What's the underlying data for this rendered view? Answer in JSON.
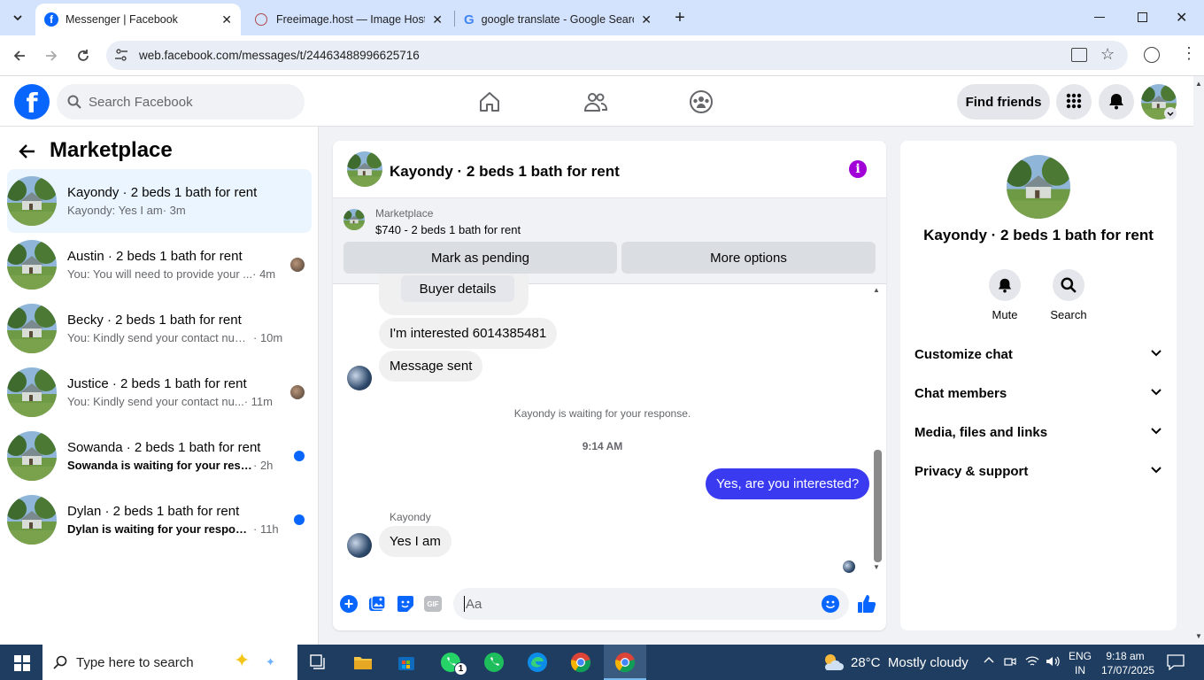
{
  "browser": {
    "tabs": [
      {
        "title": "Messenger | Facebook",
        "active": true
      },
      {
        "title": "Freeimage.host — Image Hosti",
        "active": false
      },
      {
        "title": "google translate - Google Searc",
        "active": false
      }
    ],
    "url": "web.facebook.com/messages/t/24463488996625716"
  },
  "fb_header": {
    "search_placeholder": "Search Facebook",
    "find_friends_label": "Find friends"
  },
  "sidebar": {
    "title": "Marketplace",
    "conversations": [
      {
        "title": "Kayondy · 2 beds 1 bath for rent",
        "preview": "Kayondy: Yes I am",
        "time": "· 3m",
        "unread": false,
        "selected": true,
        "indicator": "none"
      },
      {
        "title": "Austin · 2 beds 1 bath for rent",
        "preview": "You: You will need to provide your ...",
        "time": "· 4m",
        "unread": false,
        "selected": false,
        "indicator": "avatar"
      },
      {
        "title": "Becky · 2 beds 1 bath for rent",
        "preview": "You: Kindly send your contact numb...",
        "time": "· 10m",
        "unread": false,
        "selected": false,
        "indicator": "none"
      },
      {
        "title": "Justice · 2 beds 1 bath for rent",
        "preview": "You: Kindly send your contact nu...",
        "time": "· 11m",
        "unread": false,
        "selected": false,
        "indicator": "avatar"
      },
      {
        "title": "Sowanda · 2 beds 1 bath for rent",
        "preview": "Sowanda is waiting for your respo...",
        "time": "· 2h",
        "unread": true,
        "selected": false,
        "indicator": "dot"
      },
      {
        "title": "Dylan · 2 beds 1 bath for rent",
        "preview": "Dylan is waiting for your response.",
        "time": "· 11h",
        "unread": true,
        "selected": false,
        "indicator": "dot"
      }
    ]
  },
  "chat": {
    "title": "Kayondy · 2 beds 1 bath for rent",
    "listing_source": "Marketplace",
    "listing": "$740 - 2 beds 1 bath for rent",
    "mark_pending_label": "Mark as pending",
    "more_options_label": "More options",
    "buyer_details_label": "Buyer details",
    "msg_interested": "I'm interested 6014385481",
    "msg_sent": "Message sent",
    "waiting_notice": "Kayondy is waiting for your response.",
    "timestamp": "9:14 AM",
    "my_message": "Yes, are you interested?",
    "sender_name": "Kayondy",
    "reply": "Yes I am",
    "composer_placeholder": "Aa"
  },
  "info_panel": {
    "name": "Kayondy · 2 beds 1 bath for rent",
    "mute_label": "Mute",
    "search_label": "Search",
    "sections": [
      "Customize chat",
      "Chat members",
      "Media, files and links",
      "Privacy & support"
    ]
  },
  "taskbar": {
    "search_placeholder": "Type here to search",
    "weather": "28°C  Mostly cloudy",
    "lang": "ENG",
    "region": "IN",
    "time": "9:18 am",
    "date": "17/07/2025",
    "whatsapp_badge": "1"
  },
  "colors": {
    "fb_blue": "#0866ff",
    "my_bubble": "#3a3bf0",
    "info_icon": "#a100d6",
    "taskbar": "#1f3d61"
  }
}
